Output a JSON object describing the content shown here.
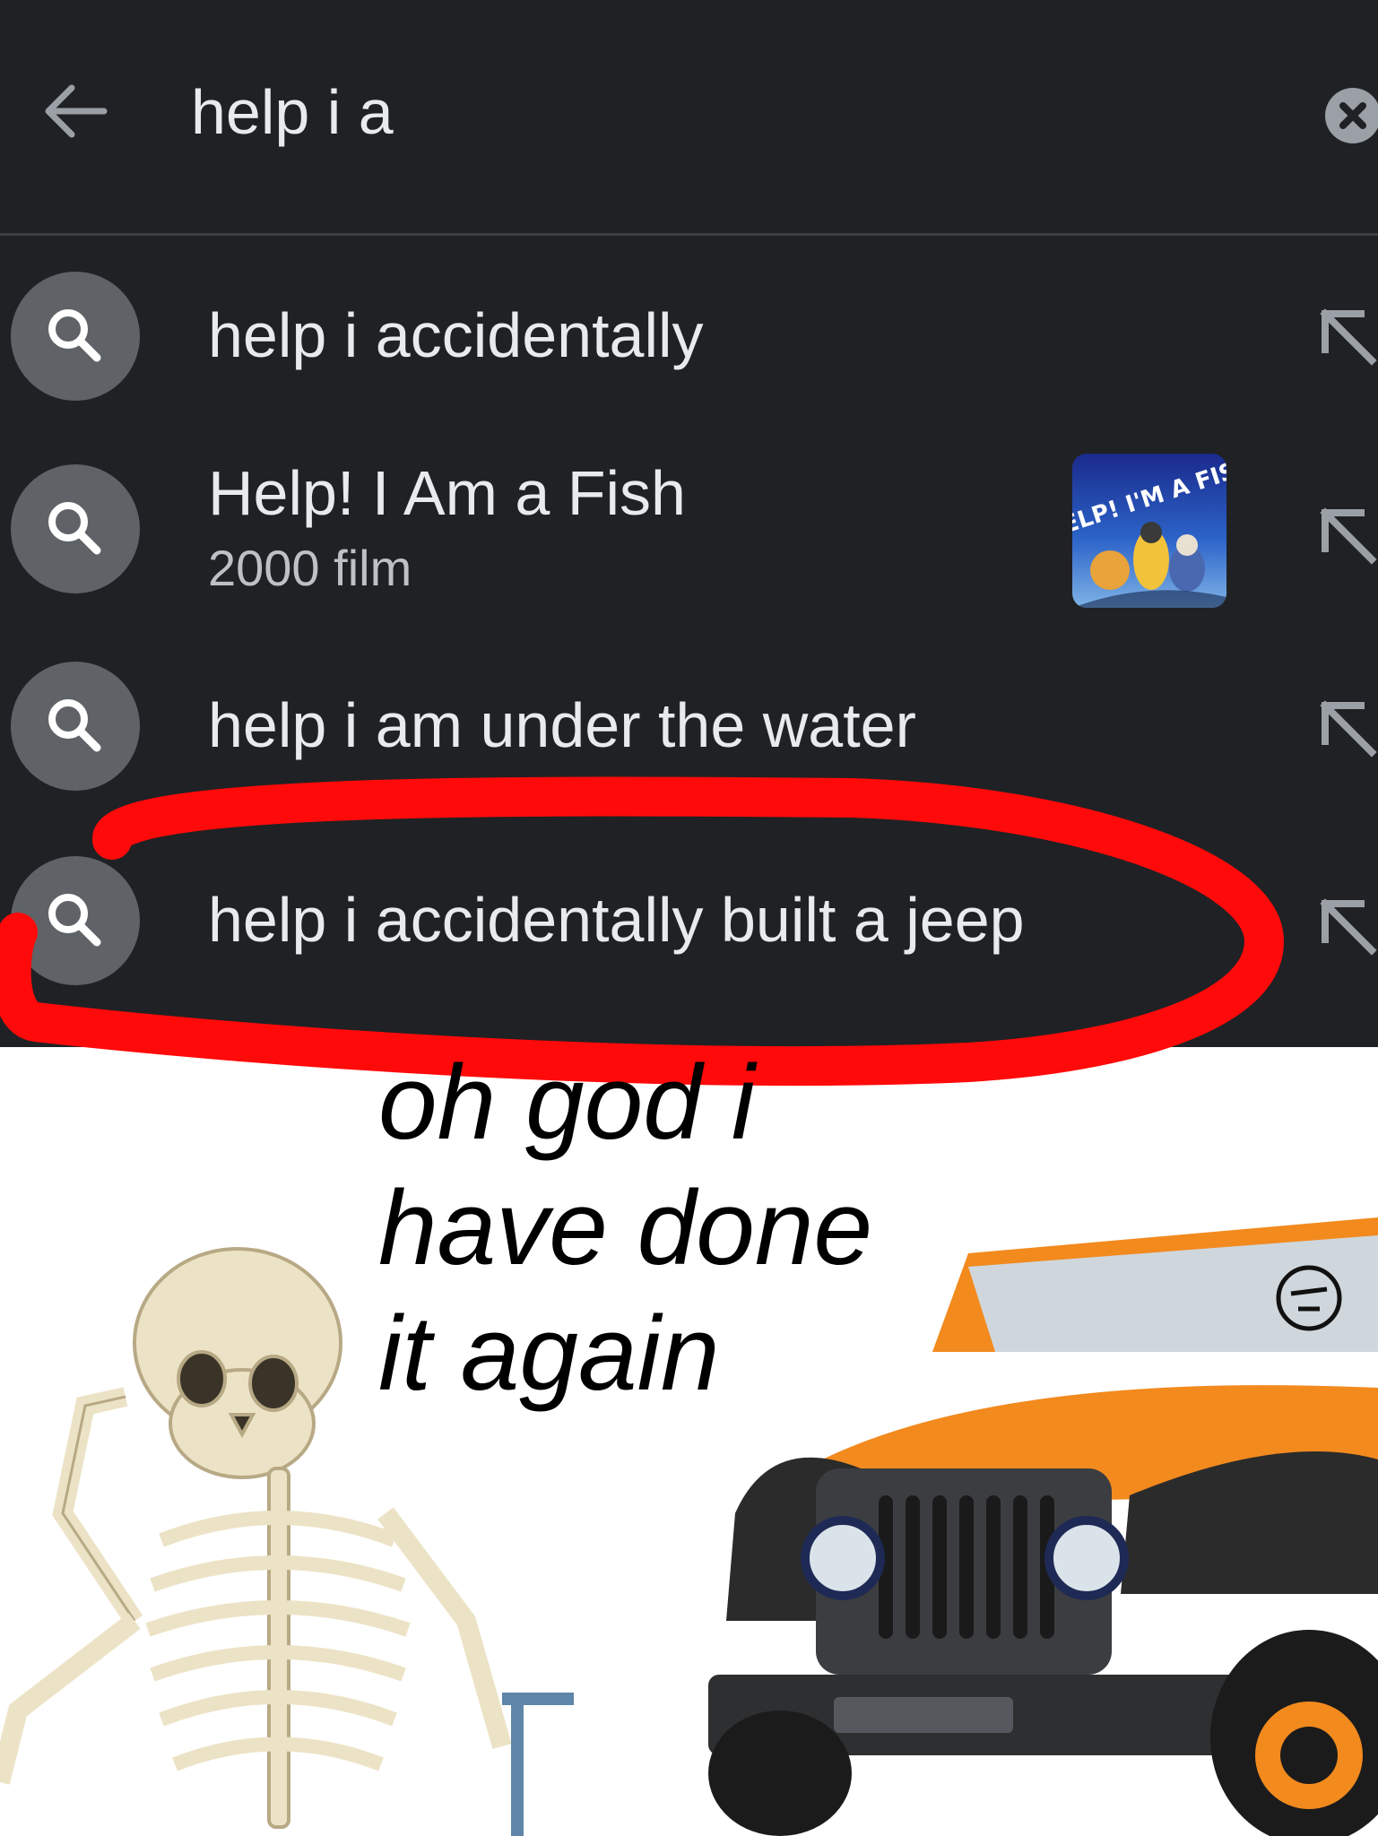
{
  "search": {
    "query": "help i a"
  },
  "suggestions": [
    {
      "label": "help i accidentally"
    },
    {
      "label": "Help! I Am a Fish",
      "subtitle": "2000 film"
    },
    {
      "label": "help i am under the water"
    },
    {
      "label": "help i accidentally built a jeep"
    }
  ],
  "thumbnail_text": "HELP! I'M A FISH",
  "caption": {
    "line1": "oh god i",
    "line2": "have done",
    "line3": "it again"
  },
  "colors": {
    "background": "#202124",
    "text": "#e8eaed",
    "icon_circle": "#5f6368",
    "annotation": "#ff0a0a"
  },
  "icons": [
    "back-arrow-icon",
    "clear-icon",
    "search-icon",
    "fill-arrow-icon"
  ]
}
